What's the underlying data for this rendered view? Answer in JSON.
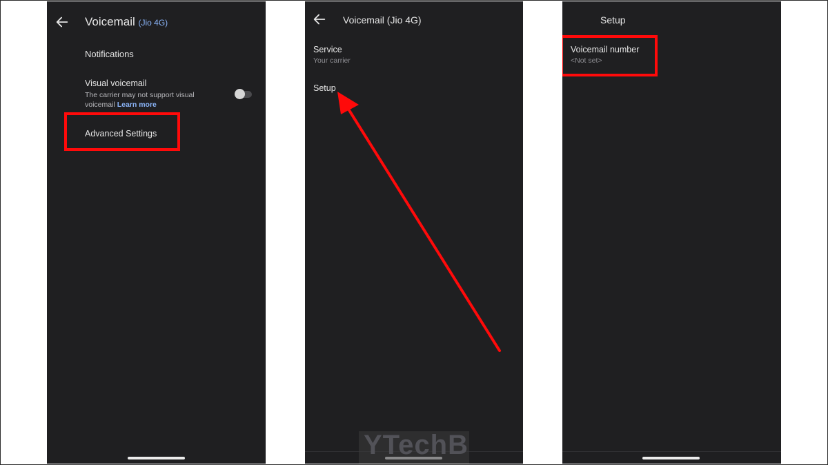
{
  "screen1": {
    "title": "Voicemail",
    "carrier": "(Jio 4G)",
    "notifications": "Notifications",
    "visual_voicemail": "Visual voicemail",
    "visual_voicemail_desc": "The carrier may not support visual voicemail",
    "learn_more": "Learn more",
    "visual_voicemail_enabled": false,
    "advanced_settings": "Advanced Settings"
  },
  "screen2": {
    "title": "Voicemail (Jio 4G)",
    "service_label": "Service",
    "service_value": "Your carrier",
    "setup_label": "Setup"
  },
  "screen3": {
    "title": "Setup",
    "voicemail_number_label": "Voicemail number",
    "voicemail_number_value": "<Not set>"
  },
  "watermark": "YTechB",
  "colors": {
    "screen_bg": "#1f1f21",
    "highlight": "#ff0a0a",
    "accent_link": "#8ab4f8"
  },
  "icons": [
    "back-arrow-icon",
    "toggle-switch",
    "pointer-arrow"
  ]
}
